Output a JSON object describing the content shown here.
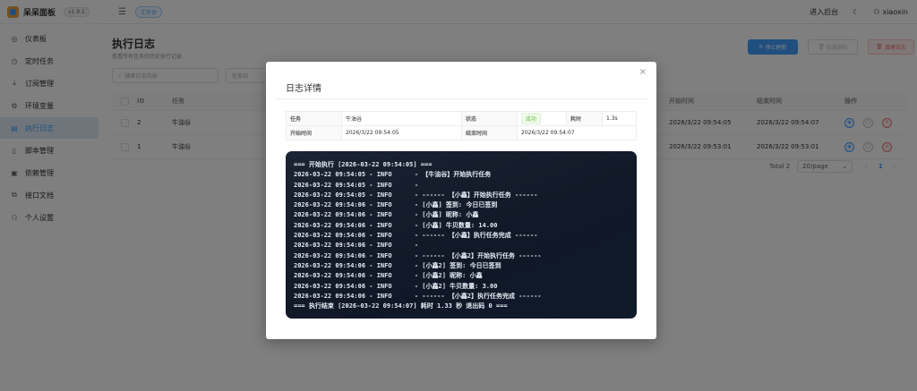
{
  "sidebar": {
    "brand": "呆呆面板",
    "version": "v1.9.1",
    "items": [
      {
        "label": "仪表板",
        "icon": "dashboard-icon"
      },
      {
        "label": "定时任务",
        "icon": "clock-icon"
      },
      {
        "label": "订阅管理",
        "icon": "download-icon"
      },
      {
        "label": "环境变量",
        "icon": "gear-icon"
      },
      {
        "label": "执行日志",
        "icon": "document-icon",
        "active": true
      },
      {
        "label": "脚本管理",
        "icon": "file-icon"
      },
      {
        "label": "依赖管理",
        "icon": "package-icon"
      },
      {
        "label": "接口文档",
        "icon": "link-icon"
      },
      {
        "label": "个人设置",
        "icon": "user-icon"
      }
    ]
  },
  "header": {
    "breadcrumb": "工作台",
    "enter_backend": "进入后台",
    "username": "xiaoxin"
  },
  "page": {
    "title": "执行日志",
    "subtitle": "查看所有任务的历史执行记录",
    "btn_stop": "停止刷新",
    "btn_batch_delete": "批量删除",
    "btn_clear": "清理日志",
    "search_placeholder": "搜索日志内容",
    "task_id_placeholder": "任务ID"
  },
  "table": {
    "headers": {
      "id": "ID",
      "task": "任务",
      "start": "开始时间",
      "end": "结束时间",
      "ops": "操作"
    },
    "rows": [
      {
        "id": "2",
        "task": "牛油谷",
        "start": "2026/3/22 09:54:05",
        "end": "2026/3/22 09:54:07"
      },
      {
        "id": "1",
        "task": "牛油谷",
        "start": "2026/3/22 09:53:01",
        "end": "2026/3/22 09:53:01"
      }
    ]
  },
  "pagination": {
    "total": "Total 2",
    "page_size": "20/page",
    "current": "1"
  },
  "dialog": {
    "title": "日志详情",
    "task_label": "任务",
    "task_value": "牛油谷",
    "status_label": "状态",
    "status_value": "成功",
    "duration_label": "耗时",
    "duration_value": "1.3s",
    "start_label": "开始时间",
    "start_value": "2026/3/22 09:54:05",
    "end_label": "结束时间",
    "end_value": "2026/3/22 09:54:07",
    "log_lines": [
      "=== 开始执行 [2026-03-22 09:54:05] ===",
      "2026-03-22 09:54:05 - INFO      - 【牛油谷】开始执行任务",
      "2026-03-22 09:54:05 - INFO      -",
      "2026-03-22 09:54:05 - INFO      - ------ 【小鑫】开始执行任务 ------",
      "2026-03-22 09:54:06 - INFO      - [小鑫] 签到: 今日已签到",
      "2026-03-22 09:54:06 - INFO      - [小鑫] 昵称: 小鑫",
      "2026-03-22 09:54:06 - INFO      - [小鑫] 牛贝数量: 14.00",
      "2026-03-22 09:54:06 - INFO      - ------ 【小鑫】执行任务完成 ------",
      "2026-03-22 09:54:06 - INFO      -",
      "2026-03-22 09:54:06 - INFO      - ------ 【小鑫2】开始执行任务 ------",
      "2026-03-22 09:54:06 - INFO      - [小鑫2] 签到: 今日已签到",
      "2026-03-22 09:54:06 - INFO      - [小鑫2] 昵称: 小鑫",
      "2026-03-22 09:54:06 - INFO      - [小鑫2] 牛贝数量: 3.00",
      "2026-03-22 09:54:06 - INFO      - ------ 【小鑫2】执行任务完成 ------",
      "=== 执行结束 [2026-03-22 09:54:07] 耗时 1.33 秒 退出码 0 ==="
    ]
  },
  "colors": {
    "primary": "#409eff",
    "success": "#67c23a",
    "danger": "#f56c6c",
    "console_bg": "#111827"
  }
}
